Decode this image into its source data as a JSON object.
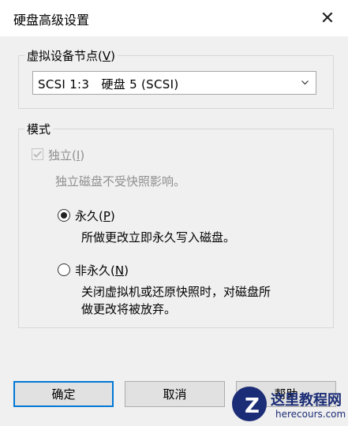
{
  "window": {
    "title": "硬盘高级设置",
    "close_glyph": "✕"
  },
  "virtual_device_node": {
    "label": "虚拟设备节点",
    "label_accel_open": "(",
    "label_accel_key": "V",
    "label_accel_close": ")",
    "selected": "SCSI 1:3   硬盘 5 (SCSI)"
  },
  "mode": {
    "label": "模式",
    "independent": {
      "label": "独立",
      "accel_open": "(",
      "accel_key": "I",
      "accel_close": ")",
      "checked": true,
      "enabled": false,
      "description": "独立磁盘不受快照影响。"
    },
    "persistent": {
      "label": "永久",
      "accel_open": "(",
      "accel_key": "P",
      "accel_close": ")",
      "selected": true,
      "description": "所做更改立即永久写入磁盘。"
    },
    "nonpersistent": {
      "label": "非永久",
      "accel_open": "(",
      "accel_key": "N",
      "accel_close": ")",
      "selected": false,
      "description_line1": "关闭虚拟机或还原快照时，对磁盘所",
      "description_line2": "做更改将被放弃。"
    }
  },
  "buttons": {
    "ok": "确定",
    "cancel": "取消",
    "help": "帮助"
  },
  "watermark": {
    "logo_letter": "Z",
    "site_name": "这里教程网",
    "site_url": "herecours.com"
  },
  "colors": {
    "accent": "#0078d7",
    "watermark": "#1b2d76"
  }
}
